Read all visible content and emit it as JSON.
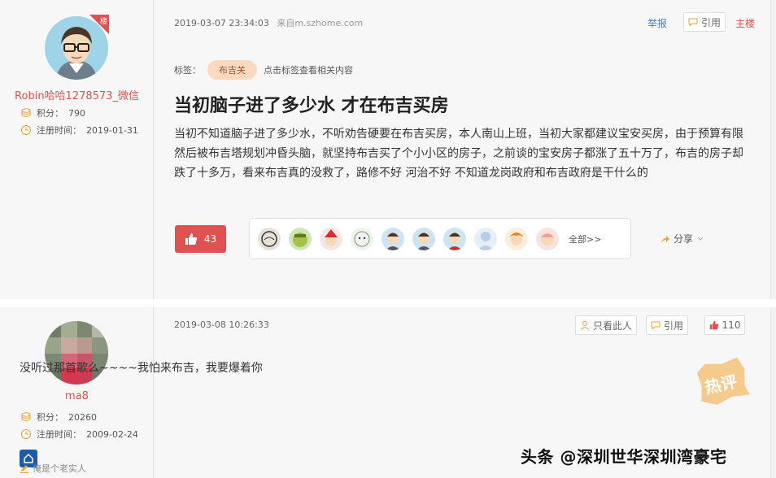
{
  "post1": {
    "floor_badge": "楼",
    "username": "Robin哈哈1278573_微信",
    "points_label": "积分：",
    "points": "790",
    "regtime_label": "注册时间：",
    "regtime": "2019-01-31",
    "timestamp": "2019-03-07 23:34:03",
    "source": "来自m.szhome.com",
    "report": "举报",
    "quote": "引用",
    "owner": "主楼",
    "tags_label": "标签：",
    "tag": "布吉关",
    "tag_hint": "点击标签查看相关内容",
    "title": "当初脑子进了多少水 才在布吉买房",
    "body": "当初不知道脑子进了多少水，不听劝告硬要在布吉买房，本人南山上班，当初大家都建议宝安买房，由于预算有限然后被布吉塔规划冲昏头脑，就坚持布吉买了个小小区的房子，之前谈的宝安房子都涨了五十万了，布吉的房子却跌了十多万，看来布吉真的没救了，路修不好 河治不好 不知道龙岗政府和布吉政府是干什么的",
    "likes": "43",
    "all_likers": "全部>>",
    "share": "分享"
  },
  "post2": {
    "username": "ma8",
    "points_label": "积分：",
    "points": "20260",
    "regtime_label": "注册时间：",
    "regtime": "2009-02-24",
    "timestamp": "2019-03-08 10:26:33",
    "only_author": "只看此人",
    "quote": "引用",
    "likes": "110",
    "reply": "没听过那首歌么~~~~我怕来布吉，我要爆着你",
    "hot_badge": "热评",
    "signature": "俺是个老实人"
  },
  "watermark": "头条 @深圳世华深圳湾豪宅",
  "colors": {
    "accent_red": "#e05252",
    "tag_bg": "#fbd9bf",
    "name_red": "#d9534f"
  }
}
